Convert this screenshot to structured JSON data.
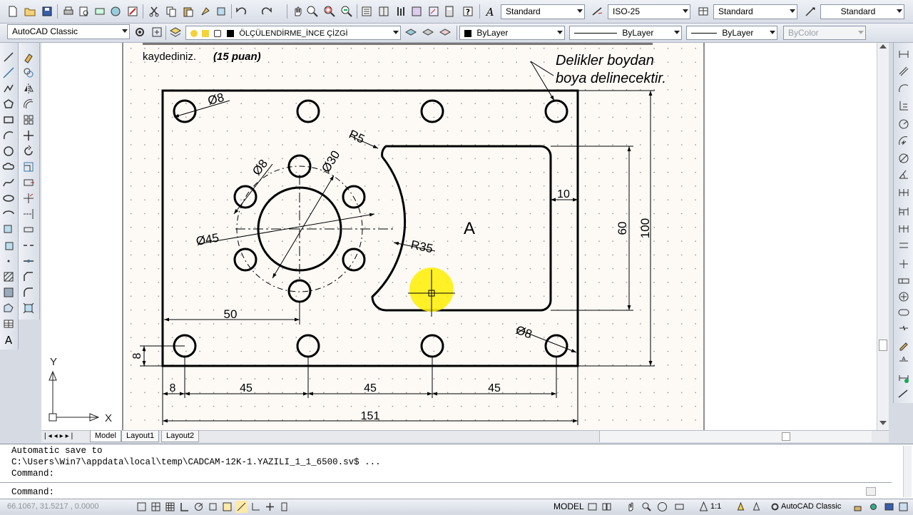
{
  "toolbar_top": {
    "text_style": "Standard",
    "dim_style": "ISO-25",
    "table_style": "Standard",
    "mleader_style": "Standard"
  },
  "toolbar_second": {
    "workspace": "AutoCAD Classic",
    "layer": "ÖLÇÜLENDİRME_İNCE ÇİZGİ",
    "color": "ByLayer",
    "linetype": "ByLayer",
    "lineweight": "ByLayer",
    "plotstyle": "ByColor"
  },
  "drawing": {
    "header_line1": "kaydediniz.",
    "header_points": "(15 puan)",
    "note_line1": "Delikler boydan",
    "note_line2": "boya delinecektir.",
    "label_a": "A",
    "dim_phi8_top": "Ø8",
    "dim_r5": "R5",
    "dim_phi8_circle": "Ø8",
    "dim_phi30": "Ø30",
    "dim_phi45": "Ø45",
    "dim_r35": "R35",
    "dim_10": "10",
    "dim_60": "60",
    "dim_100": "100",
    "dim_50": "50",
    "dim_phi8_bottom": "Ø8",
    "dim_8_left": "8",
    "dim_8_bottom": "8",
    "dim_45_1": "45",
    "dim_45_2": "45",
    "dim_45_3": "45",
    "dim_151": "151",
    "ucs_y": "Y",
    "ucs_x": "X"
  },
  "tabs": [
    "Model",
    "Layout1",
    "Layout2"
  ],
  "command": {
    "line1": "Automatic save to",
    "line2": "C:\\Users\\Win7\\appdata\\local\\temp\\CADCAM-12K-1.YAZILI_1_1_6500.sv$ ...",
    "line3": "Command:",
    "prompt": "Command:"
  },
  "status": {
    "coords": "66.1067, 31.5217 , 0.0000",
    "model": "MODEL",
    "scale": "1:1",
    "workspace": "AutoCAD Classic"
  },
  "colors": {
    "highlight": "#ffee00",
    "chrome": "#d6dbe3"
  }
}
